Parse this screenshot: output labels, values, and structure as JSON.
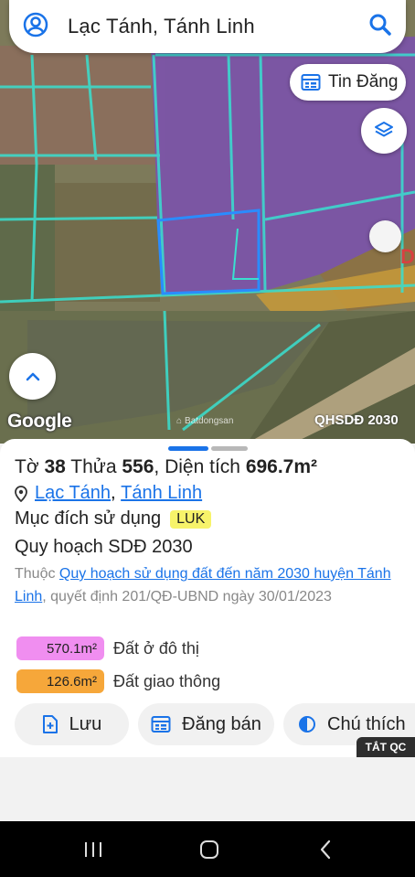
{
  "search": {
    "text": "Lạc Tánh, Tánh Linh"
  },
  "map": {
    "tin_dang_label": "Tin Đăng",
    "google_logo": "Google",
    "watermark": "Batdongsan",
    "overlay_label": "QHSDĐ 2030",
    "icons": [
      "user-icon",
      "search-icon",
      "calendar-icon",
      "layers-icon",
      "chevron-up-icon"
    ]
  },
  "parcel": {
    "to_label": "Tờ",
    "to_number": "38",
    "thua_label": "Thửa",
    "thua_number": "556",
    "area_label": ", Diện tích",
    "area_value": "696.7m²",
    "location_ward": "Lạc Tánh",
    "location_sep": ", ",
    "location_district": "Tánh Linh",
    "purpose_label": "Mục đích sử dụng",
    "purpose_code": "LUK",
    "plan_title": "Quy hoạch SDĐ 2030",
    "desc_prefix": "Thuộc ",
    "desc_link": "Quy hoạch sử dụng đất đến năm 2030 huyện Tánh Linh",
    "desc_suffix": ", quyết định 201/QĐ-UBND ngày 30/01/2023"
  },
  "legend": [
    {
      "area": "570.1m²",
      "label": "Đất ở đô thị",
      "color": "#f08ef0"
    },
    {
      "area": "126.6m²",
      "label": "Đất giao thông",
      "color": "#f6a73a"
    }
  ],
  "actions": {
    "save_label": "Lưu",
    "sell_label": "Đăng bán",
    "legend_label": "Chú thích"
  },
  "ad": {
    "close_label": "TẮT QC"
  },
  "colors": {
    "accent": "#1a73e8",
    "luk": "#f7f36a"
  }
}
